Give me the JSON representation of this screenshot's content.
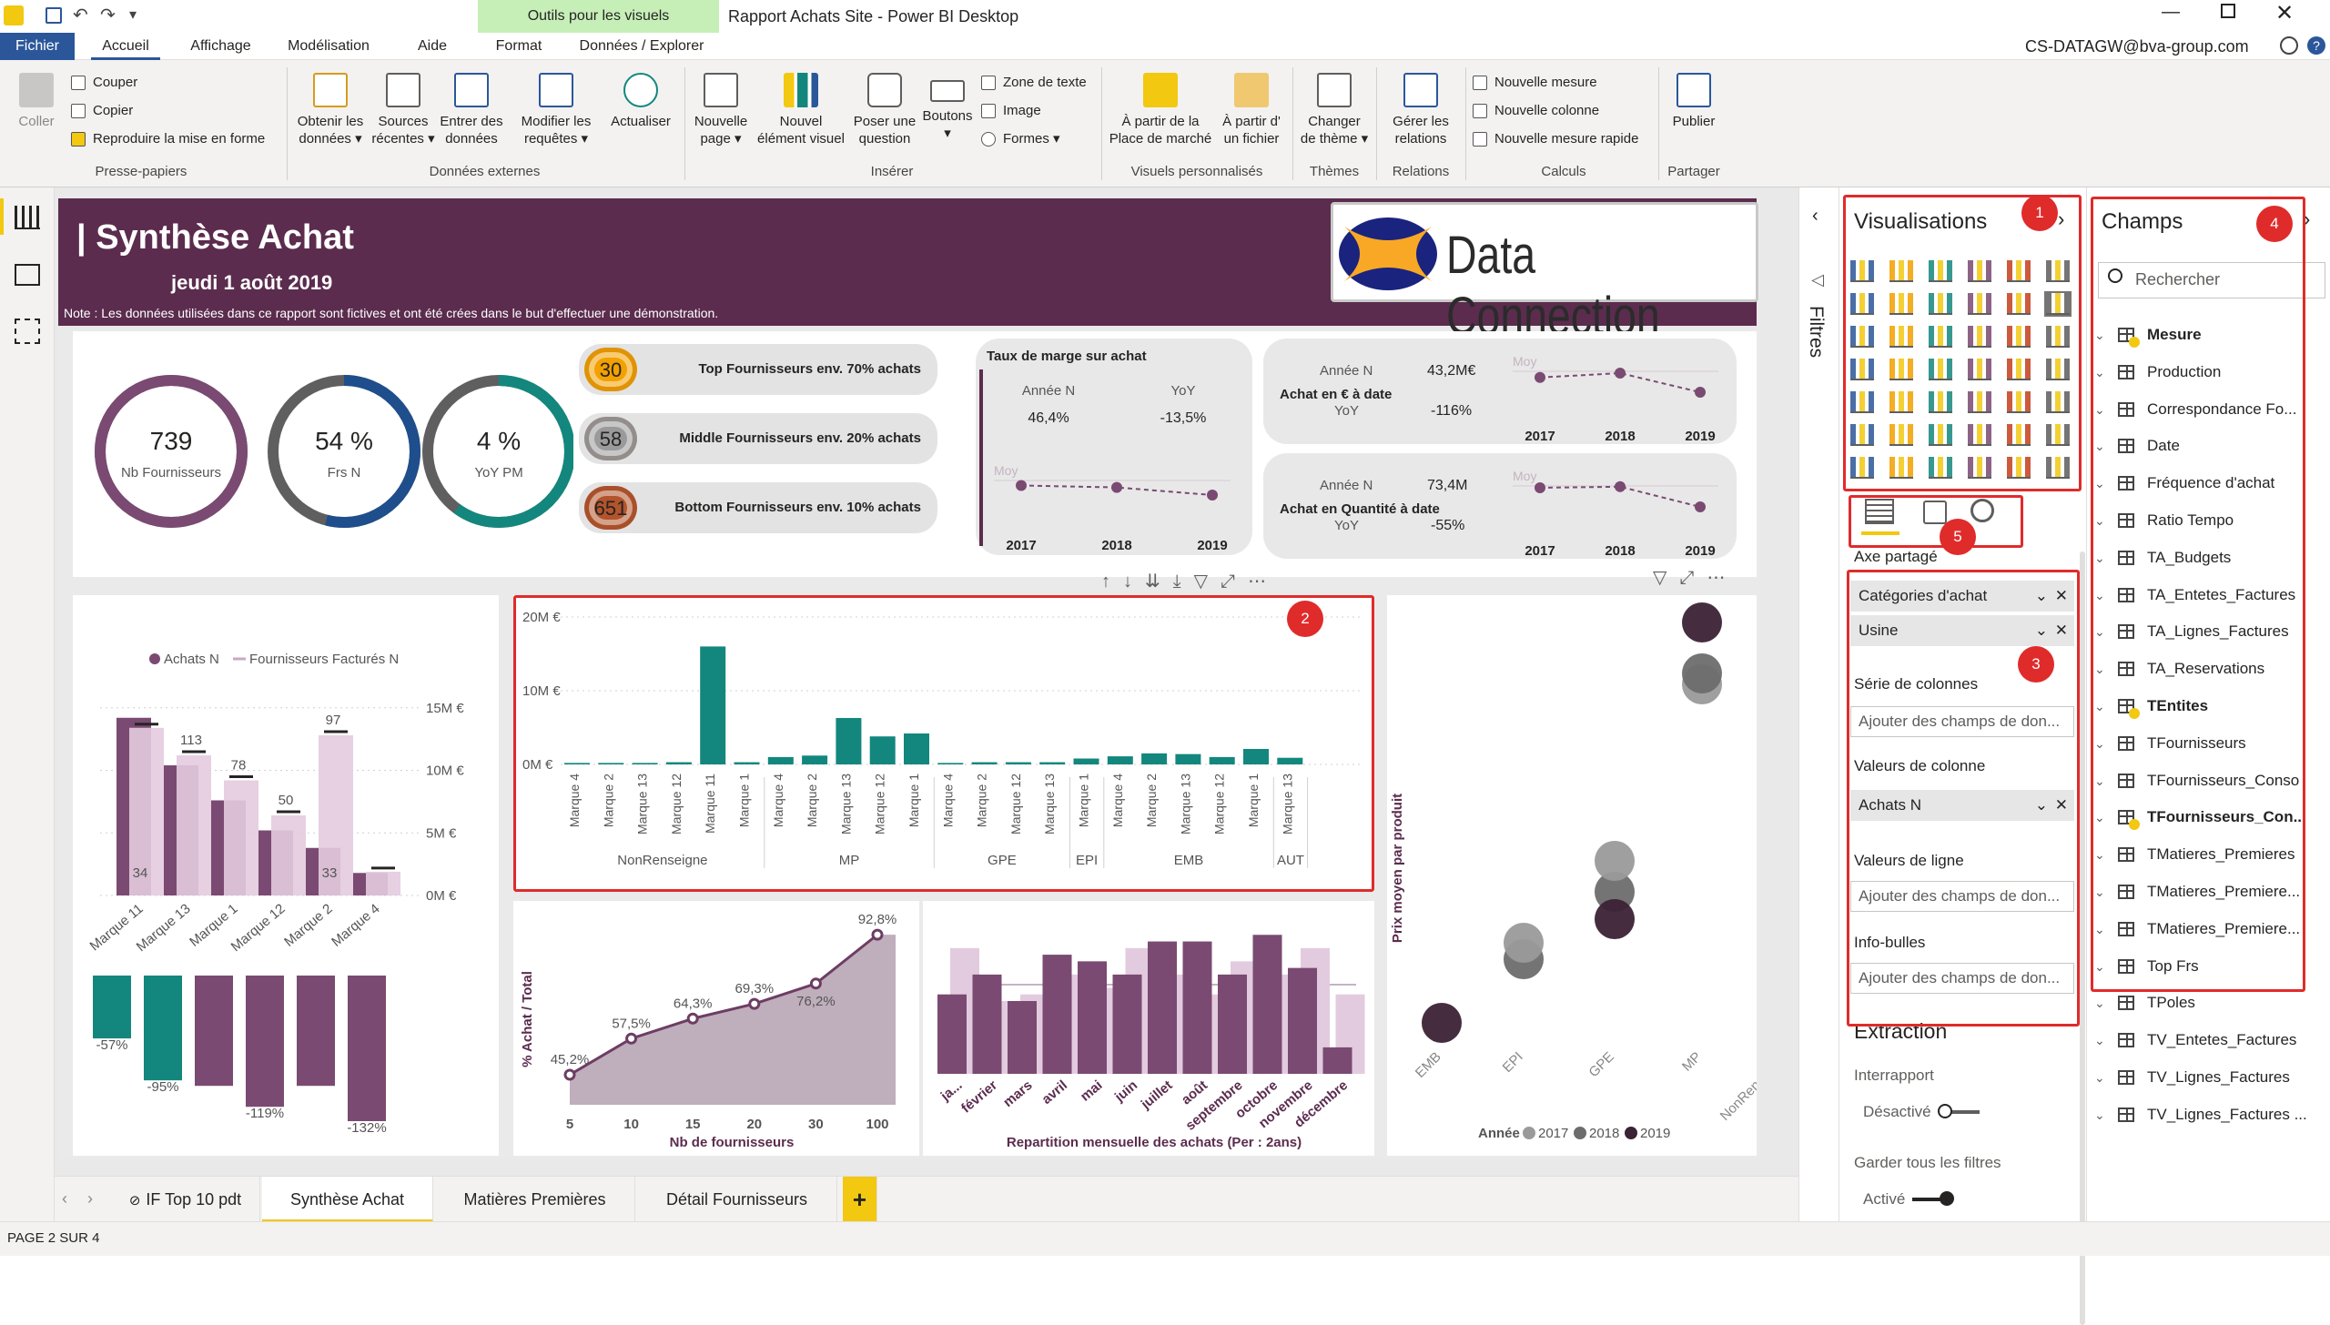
{
  "window": {
    "title": "Rapport Achats Site - Power BI Desktop",
    "user": "CS-DATAGW@bva-group.com",
    "contextual_group": "Outils pour les visuels",
    "qat_more": "▾"
  },
  "menu": {
    "tabs": [
      "Fichier",
      "Accueil",
      "Affichage",
      "Modélisation",
      "Aide",
      "Format",
      "Données / Explorer"
    ]
  },
  "ribbon": {
    "clipboard": {
      "paste": "Coller",
      "cut": "Couper",
      "copy": "Copier",
      "format_painter": "Reproduire la mise en forme",
      "group": "Presse-papiers"
    },
    "external": {
      "get_data": "Obtenir les\ndonnées ▾",
      "recent": "Sources\nrécentes ▾",
      "enter": "Entrer des\ndonnées",
      "edit": "Modifier les\nrequêtes ▾",
      "refresh": "Actualiser",
      "group": "Données externes"
    },
    "insert": {
      "new_page": "Nouvelle\npage ▾",
      "new_visual": "Nouvel\nélément visuel",
      "ask": "Poser une\nquestion",
      "buttons": "Boutons\n▾",
      "textbox": "Zone de texte",
      "image": "Image",
      "shapes": "Formes ▾",
      "group": "Insérer"
    },
    "custom": {
      "marketplace": "À partir de la\nPlace de marché",
      "file": "À partir d'\nun fichier",
      "group": "Visuels personnalisés"
    },
    "themes": {
      "change": "Changer\nde thème ▾",
      "group": "Thèmes"
    },
    "relations": {
      "manage": "Gérer les\nrelations",
      "group": "Relations"
    },
    "calc": {
      "measure": "Nouvelle mesure",
      "column": "Nouvelle colonne",
      "quick": "Nouvelle mesure rapide",
      "group": "Calculs"
    },
    "share": {
      "publish": "Publier",
      "group": "Partager"
    }
  },
  "report": {
    "title": "| Synthèse Achat",
    "date": "jeudi 1 août 2019",
    "note": "Note : Les données utilisées dans ce rapport  sont fictives et ont été crées dans le but d'effectuer une démonstration.",
    "logo_text": "Data Connection",
    "rings": [
      {
        "value": "739",
        "label": "Nb Fournisseurs",
        "color": "#7a4a72",
        "fill": 1.0
      },
      {
        "value": "54 %",
        "label": "Frs N",
        "color": "#1f4e8c",
        "fill": 0.54
      },
      {
        "value": "4 %",
        "label": "YoY PM",
        "color": "#13877d",
        "fill": 0.6
      }
    ],
    "segments": [
      {
        "num": "30",
        "label": "Top Fournisseurs env. 70% achats",
        "color": "#f2a100"
      },
      {
        "num": "58",
        "label": "Middle Fournisseurs env. 20% achats",
        "color": "#9a9a9a"
      },
      {
        "num": "651",
        "label": "Bottom Fournisseurs env. 10% achats",
        "color": "#b3542c"
      }
    ],
    "marge": {
      "title": "Taux de marge sur achat",
      "col1": "Année N",
      "col2": "YoY",
      "val1": "46,4%",
      "val2": "-13,5%",
      "moy": "Moy",
      "years": [
        "2017",
        "2018",
        "2019"
      ],
      "trend": [
        0.55,
        0.52,
        0.4
      ]
    },
    "achat_euro": {
      "l1": "Année N",
      "v1": "43,2M€",
      "l2": "Achat en € à date",
      "l3": "YoY",
      "v2": "-116%",
      "moy": "Moy",
      "years": [
        "2017",
        "2018",
        "2019"
      ],
      "trend": [
        0.62,
        0.7,
        0.35
      ]
    },
    "achat_qte": {
      "l1": "Année N",
      "v1": "73,4M",
      "l2": "Achat en Quantité à date",
      "l3": "YoY",
      "v2": "-55%",
      "moy": "Moy",
      "years": [
        "2017",
        "2018",
        "2019"
      ],
      "trend": [
        0.7,
        0.72,
        0.35
      ]
    },
    "combo": {
      "legend1": "Achats N",
      "legend2": "Fournisseurs Facturés N",
      "yticks": [
        "15M €",
        "10M €",
        "5M €",
        "0M €"
      ],
      "categories": [
        "Marque 11",
        "Marque 13",
        "Marque 1",
        "Marque 12",
        "Marque 2",
        "Marque 4"
      ],
      "bars_dark": [
        14.2,
        10.4,
        7.6,
        5.2,
        3.8,
        1.8
      ],
      "bars_light": [
        13.4,
        11.2,
        9.2,
        6.4,
        12.8,
        1.9
      ],
      "labels_top": [
        "",
        "113",
        "78",
        "50",
        "97",
        ""
      ],
      "labels_low": [
        "34",
        "",
        "",
        "",
        "33",
        ""
      ],
      "yoy": [
        -0.57,
        -0.95,
        -1.0,
        -1.19,
        -1.0,
        -1.32
      ],
      "yoy_labels": [
        "-57%",
        "-95%",
        "",
        "-119%",
        "",
        "-132%"
      ]
    },
    "main_bar": {
      "yticks": [
        "20M €",
        "10M €",
        "0M €"
      ],
      "marques": [
        "Marque 4",
        "Marque 2",
        "Marque 13",
        "Marque 12",
        "Marque 11",
        "Marque 1",
        "Marque 4",
        "Marque 2",
        "Marque 13",
        "Marque 12",
        "Marque 1",
        "Marque 4",
        "Marque 2",
        "Marque 12",
        "Marque 13",
        "Marque 1",
        "Marque 4",
        "Marque 2",
        "Marque 13",
        "Marque 12",
        "Marque 1",
        "Marque 13"
      ],
      "values": [
        0.2,
        0.2,
        0.2,
        0.3,
        16.0,
        0.3,
        1.0,
        1.2,
        6.3,
        3.8,
        4.2,
        0.2,
        0.3,
        0.3,
        0.3,
        0.8,
        1.1,
        1.5,
        1.4,
        1.0,
        2.1,
        0.9
      ],
      "groups": [
        {
          "label": "NonRenseigne",
          "start": 0,
          "end": 5
        },
        {
          "label": "MP",
          "start": 6,
          "end": 10
        },
        {
          "label": "GPE",
          "start": 11,
          "end": 14
        },
        {
          "label": "EPI",
          "start": 15,
          "end": 15
        },
        {
          "label": "EMB",
          "start": 16,
          "end": 20
        },
        {
          "label": "AUT",
          "start": 21,
          "end": 21
        }
      ]
    },
    "pareto": {
      "ylabel": "% Achat / Total",
      "xlabel": "Nb de fournisseurs",
      "x": [
        "5",
        "10",
        "15",
        "20",
        "30",
        "100"
      ],
      "values": [
        45.2,
        57.5,
        64.3,
        69.3,
        76.2,
        92.8
      ],
      "labels": [
        "45,2%",
        "57,5%",
        "64,3%",
        "69,3%",
        "76,2%",
        "92,8%"
      ]
    },
    "monthly": {
      "xlabel": "Repartition mensuelle des achats (Per : 2ans)",
      "months": [
        "ja...",
        "février",
        "mars",
        "avril",
        "mai",
        "juin",
        "juillet",
        "août",
        "septembre",
        "octobre",
        "novembre",
        "décembre"
      ],
      "prev": [
        95,
        55,
        60,
        75,
        65,
        95,
        75,
        60,
        85,
        75,
        95,
        60
      ],
      "curr": [
        60,
        75,
        55,
        90,
        85,
        75,
        100,
        100,
        75,
        105,
        80,
        20
      ]
    },
    "scatter": {
      "ylabel": "Prix moyen par produit",
      "categories": [
        "EMB",
        "EPI",
        "GPE",
        "MP",
        "NonRenseigne"
      ],
      "legend_title": "Année",
      "years": [
        "2017",
        "2018",
        "2019"
      ],
      "colors": [
        "#9a9a9a",
        "#6d6d6d",
        "#3b2235"
      ]
    }
  },
  "panes": {
    "filtres": "Filtres",
    "viz_title": "Visualisations",
    "fields_title": "Champs",
    "search_placeholder": "Rechercher",
    "wells": {
      "axe": "Axe partagé",
      "axe_items": [
        "Catégories d'achat",
        "Usine"
      ],
      "serie": "Série de colonnes",
      "add": "Ajouter des champs de don...",
      "valeurs_col": "Valeurs de colonne",
      "valeurs_col_item": "Achats N",
      "valeurs_ligne": "Valeurs de ligne",
      "infobulles": "Info-bulles",
      "extraction": "Extraction",
      "interrapport": "Interrapport",
      "desactive": "Désactivé",
      "garder": "Garder tous les filtres",
      "active": "Activé"
    },
    "fields": [
      {
        "name": "Mesure",
        "bold": true
      },
      {
        "name": "Production",
        "bold": false
      },
      {
        "name": "Correspondance Fo...",
        "bold": false
      },
      {
        "name": "Date",
        "bold": false
      },
      {
        "name": "Fréquence d'achat",
        "bold": false
      },
      {
        "name": "Ratio Tempo",
        "bold": false
      },
      {
        "name": "TA_Budgets",
        "bold": false
      },
      {
        "name": "TA_Entetes_Factures",
        "bold": false
      },
      {
        "name": "TA_Lignes_Factures",
        "bold": false
      },
      {
        "name": "TA_Reservations",
        "bold": false
      },
      {
        "name": "TEntites",
        "bold": true
      },
      {
        "name": "TFournisseurs",
        "bold": false
      },
      {
        "name": "TFournisseurs_Conso",
        "bold": false
      },
      {
        "name": "TFournisseurs_Con...",
        "bold": true
      },
      {
        "name": "TMatieres_Premieres",
        "bold": false
      },
      {
        "name": "TMatieres_Premiere...",
        "bold": false
      },
      {
        "name": "TMatieres_Premiere...",
        "bold": false
      },
      {
        "name": "Top Frs",
        "bold": false
      },
      {
        "name": "TPoles",
        "bold": false
      },
      {
        "name": "TV_Entetes_Factures",
        "bold": false
      },
      {
        "name": "TV_Lignes_Factures",
        "bold": false
      },
      {
        "name": "TV_Lignes_Factures ...",
        "bold": false
      }
    ],
    "badges": [
      "1",
      "2",
      "3",
      "4",
      "5"
    ]
  },
  "pages": {
    "tabs": [
      "IF Top 10 pdt",
      "Synthèse Achat",
      "Matières Premières",
      "Détail Fournisseurs"
    ],
    "add": "+",
    "status": "PAGE 2 SUR 4"
  },
  "colors": {
    "primary": "#5b2c4e",
    "teal": "#13877d",
    "accent": "#f2c811",
    "light": "#e3cbdf"
  }
}
